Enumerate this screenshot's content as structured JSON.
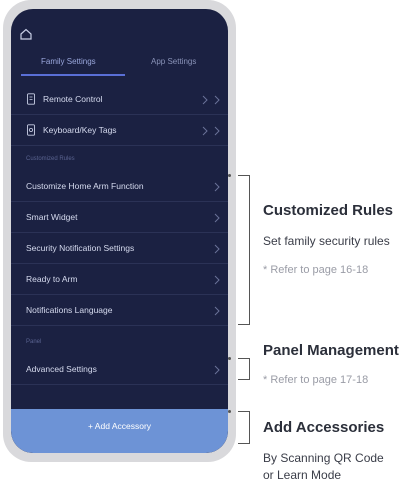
{
  "tabs": [
    {
      "label": "Family Settings",
      "active": true
    },
    {
      "label": "App Settings",
      "active": false
    }
  ],
  "device_rows": [
    {
      "label": "Remote Control",
      "icon": "remote-icon"
    },
    {
      "label": "Keyboard/Key Tags",
      "icon": "keypad-icon"
    }
  ],
  "sections": {
    "customized": "Customized Rules",
    "panel": "Panel"
  },
  "customized_rows": [
    {
      "label": "Customize Home Arm Function"
    },
    {
      "label": "Smart Widget"
    },
    {
      "label": "Security Notification Settings"
    },
    {
      "label": "Ready to Arm"
    },
    {
      "label": "Notifications Language"
    }
  ],
  "panel_rows": [
    {
      "label": "Advanced Settings"
    }
  ],
  "add_accessory": "+ Add Accessory",
  "annotations": {
    "customized": {
      "title": "Customized Rules",
      "text": "Set family security rules",
      "note": "*  Refer to page 16-18"
    },
    "panel": {
      "title": "Panel Management",
      "note": "*  Refer to page 17-18"
    },
    "accessories": {
      "title": "Add Accessories",
      "text_1": "By Scanning QR Code",
      "text_2": "or Learn Mode"
    }
  },
  "colors": {
    "screen_bg": "#1b2142",
    "accent": "#5a6fd6",
    "add_button": "#6d93d6",
    "phone_frame": "#d9d9dc"
  }
}
